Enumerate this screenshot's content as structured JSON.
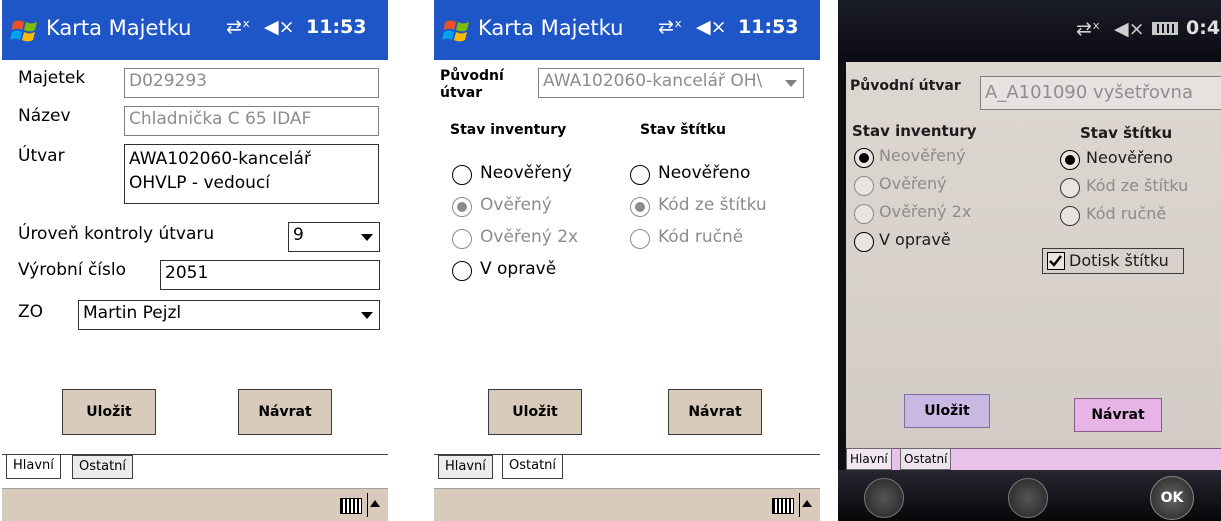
{
  "colors": {
    "titlebar": "#1e56c8",
    "titlebar_dark": "#0a0f22",
    "button_bg": "#d8cbbb",
    "photo_bg": "#dcd6d0",
    "photo_tab_bg": "#f0c8ee"
  },
  "status": {
    "time": "11:53",
    "time_partial": "0:4"
  },
  "screen1": {
    "app_title": "Karta Majetku",
    "fields": {
      "majetek": {
        "label": "Majetek",
        "value": "D029293"
      },
      "nazev": {
        "label": "Název",
        "value": "Chladnička C 65 IDAF"
      },
      "utvar": {
        "label": "Útvar",
        "value_line1": "AWA102060-kancelář",
        "value_line2": "OHVLP - vedoucí"
      },
      "uroven": {
        "label": "Úroveň kontroly útvaru",
        "value": "9"
      },
      "vyrobni": {
        "label": "Výrobní číslo",
        "value": "2051"
      },
      "zo": {
        "label": "ZO",
        "value": "Martin Pejzl"
      }
    },
    "buttons": {
      "save": "Uložit",
      "back": "Návrat"
    },
    "tabs": {
      "main": "Hlavní",
      "other": "Ostatní"
    }
  },
  "screen2": {
    "app_title": "Karta Majetku",
    "puvodni_label_line1": "Původní",
    "puvodni_label_line2": "útvar",
    "puvodni_value": "AWA102060-kancelář OH\\",
    "stav_inventury": "Stav inventury",
    "stav_stitku": "Stav štítku",
    "inventory_options": [
      "Neověřený",
      "Ověřený",
      "Ověřený 2x",
      "V opravě"
    ],
    "label_options": [
      "Neověřeno",
      "Kód ze štítku",
      "Kód ručně"
    ],
    "buttons": {
      "save": "Uložit",
      "back": "Návrat"
    },
    "tabs": {
      "main": "Hlavní",
      "other": "Ostatní"
    }
  },
  "screen3": {
    "puvodni_label": "Původní útvar",
    "puvodni_value": "A_A101090 vyšetřovna",
    "stav_inventury": "Stav inventury",
    "stav_stitku": "Stav štítku",
    "inventory_options": [
      "Neověřený",
      "Ověřený",
      "Ověřený 2x",
      "V opravě"
    ],
    "label_options": [
      "Neověřeno",
      "Kód ze štítku",
      "Kód ručně"
    ],
    "dotisk": "Dotisk štítku",
    "buttons": {
      "save": "Uložit",
      "back": "Návrat"
    },
    "tabs": {
      "main": "Hlavní",
      "other": "Ostatní"
    },
    "softkey_ok": "OK"
  }
}
